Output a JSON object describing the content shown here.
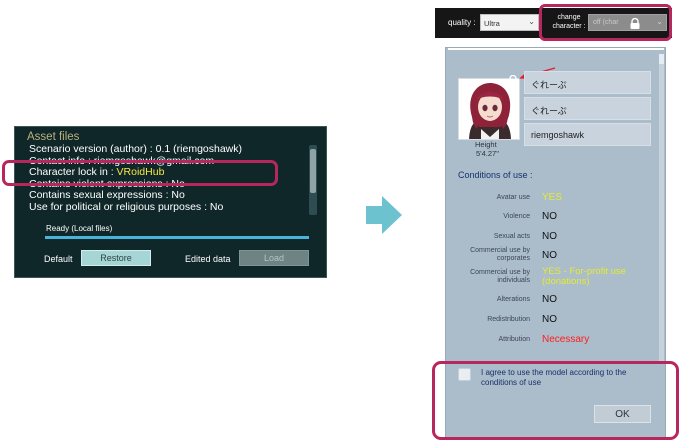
{
  "asset_panel": {
    "title": "Asset files",
    "rows": [
      {
        "label": "Scenario version (author) : 0.1 (riemgoshawk)",
        "value": ""
      },
      {
        "label": "Contact info : riemgoshawk@gmail.com",
        "value": ""
      },
      {
        "label": "Character lock in : ",
        "value": "VRoidHub"
      },
      {
        "label": "Contains violent expressions : No",
        "value": ""
      },
      {
        "label": "Contains sexual expressions : No",
        "value": ""
      },
      {
        "label": "Use for political or religious purposes : No",
        "value": ""
      }
    ],
    "status": "Ready (Local files)",
    "progress": 1.0,
    "default_label": "Default",
    "restore_label": "Restore",
    "edited_label": "Edited data",
    "load_label": "Load"
  },
  "top_bar": {
    "quality_label": "quality :",
    "quality_value": "Ultra",
    "change_label_line1": "change",
    "change_label_line2": "character :",
    "character_value": "off (char"
  },
  "dialog": {
    "names": [
      "ぐれーぷ",
      "ぐれーぷ",
      "riemgoshawk"
    ],
    "height_label": "Height",
    "height_value": "5'4.27\"",
    "conditions_title": "Conditions of use :",
    "conditions": [
      {
        "label": "Avatar use",
        "value": "YES",
        "style": "yes"
      },
      {
        "label": "Violence",
        "value": "NO",
        "style": "no"
      },
      {
        "label": "Sexual acts",
        "value": "NO",
        "style": "no"
      },
      {
        "label": "Commercial use by corporates",
        "value": "NO",
        "style": "no"
      },
      {
        "label": "Commercial use by individuals",
        "value": "YES - For-profit use (donations)",
        "style": "yes"
      },
      {
        "label": "Alterations",
        "value": "NO",
        "style": "no"
      },
      {
        "label": "Redistribution",
        "value": "NO",
        "style": "no"
      },
      {
        "label": "Attribution",
        "value": "Necessary",
        "style": "necessary"
      }
    ],
    "agree_text": "I agree to use the model according to the conditions of use",
    "ok_label": "OK"
  },
  "colors": {
    "highlight": "#b8265e",
    "accent_arrow": "#6cc3cf",
    "yes": "#e5ec2f",
    "necessary": "#ff1e1e"
  }
}
